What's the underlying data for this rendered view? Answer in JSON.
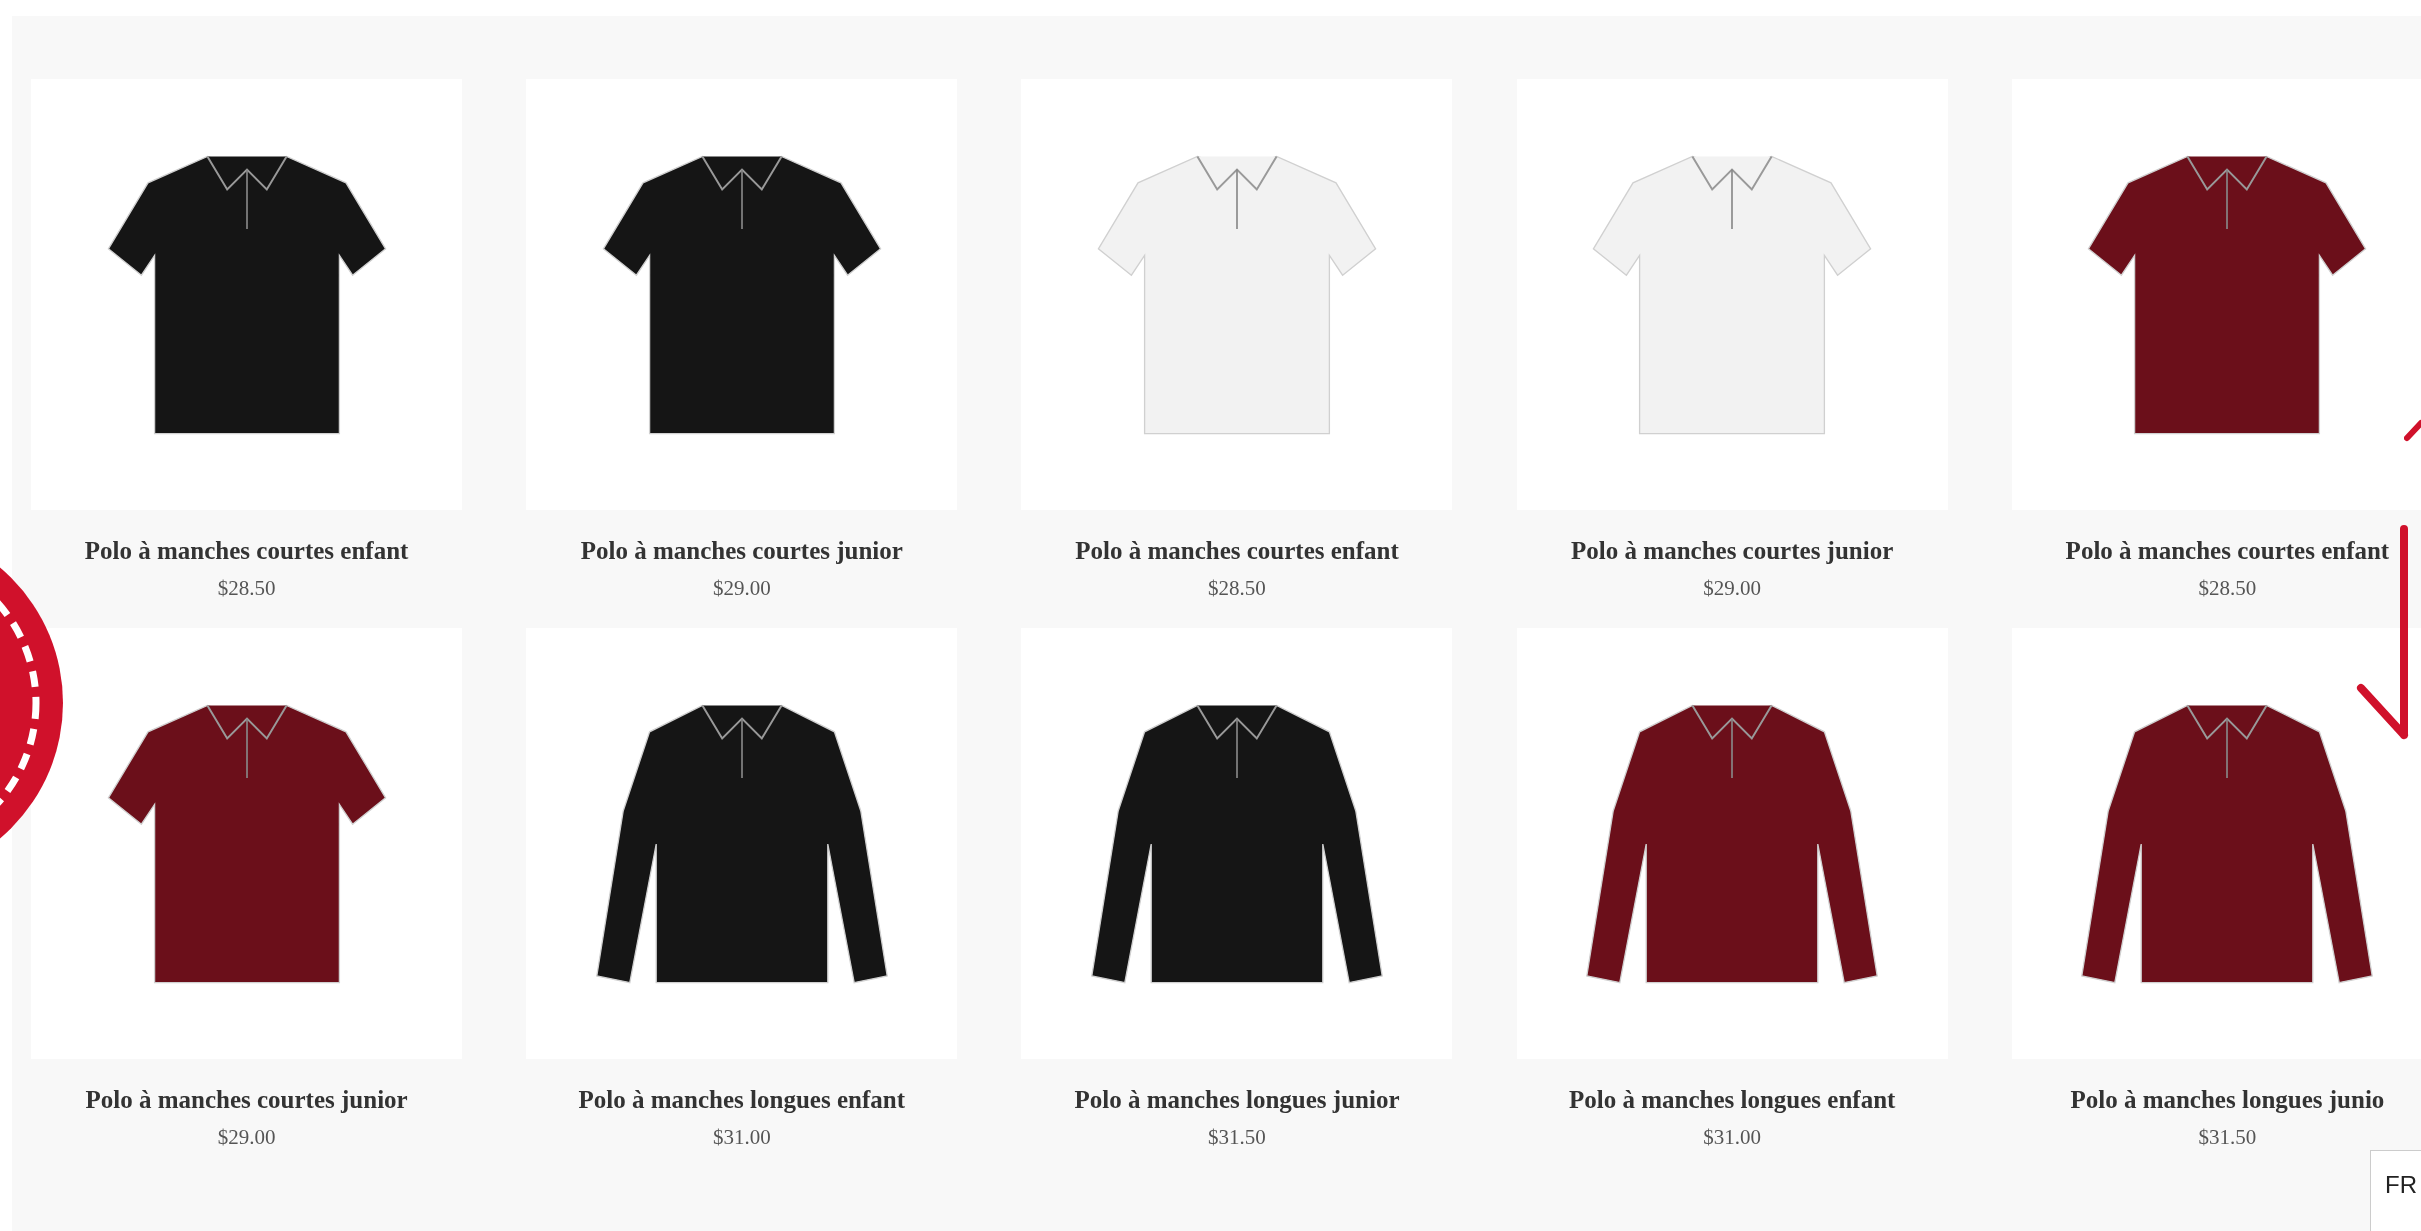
{
  "products": [
    {
      "name": "Polo à manches courtes enfant",
      "price": "$28.50",
      "kind": "short",
      "color": "#151515"
    },
    {
      "name": "Polo à manches courtes junior",
      "price": "$29.00",
      "kind": "short",
      "color": "#151515"
    },
    {
      "name": "Polo à manches courtes enfant",
      "price": "$28.50",
      "kind": "short",
      "color": "#f2f2f2"
    },
    {
      "name": "Polo à manches courtes junior",
      "price": "$29.00",
      "kind": "short",
      "color": "#f2f2f2"
    },
    {
      "name": "Polo à manches courtes enfant",
      "price": "$28.50",
      "kind": "short",
      "color": "#6b0f1a"
    },
    {
      "name": "Polo à manches courtes junior",
      "price": "$29.00",
      "kind": "short",
      "color": "#6b0f1a"
    },
    {
      "name": "Polo à manches longues enfant",
      "price": "$31.00",
      "kind": "long",
      "color": "#151515"
    },
    {
      "name": "Polo à manches longues junior",
      "price": "$31.50",
      "kind": "long",
      "color": "#151515"
    },
    {
      "name": "Polo à manches longues enfant",
      "price": "$31.00",
      "kind": "long",
      "color": "#6b0f1a"
    },
    {
      "name": "Polo à manches longues junio",
      "price": "$31.50",
      "kind": "long",
      "color": "#6b0f1a"
    }
  ],
  "language_badge": "FR"
}
